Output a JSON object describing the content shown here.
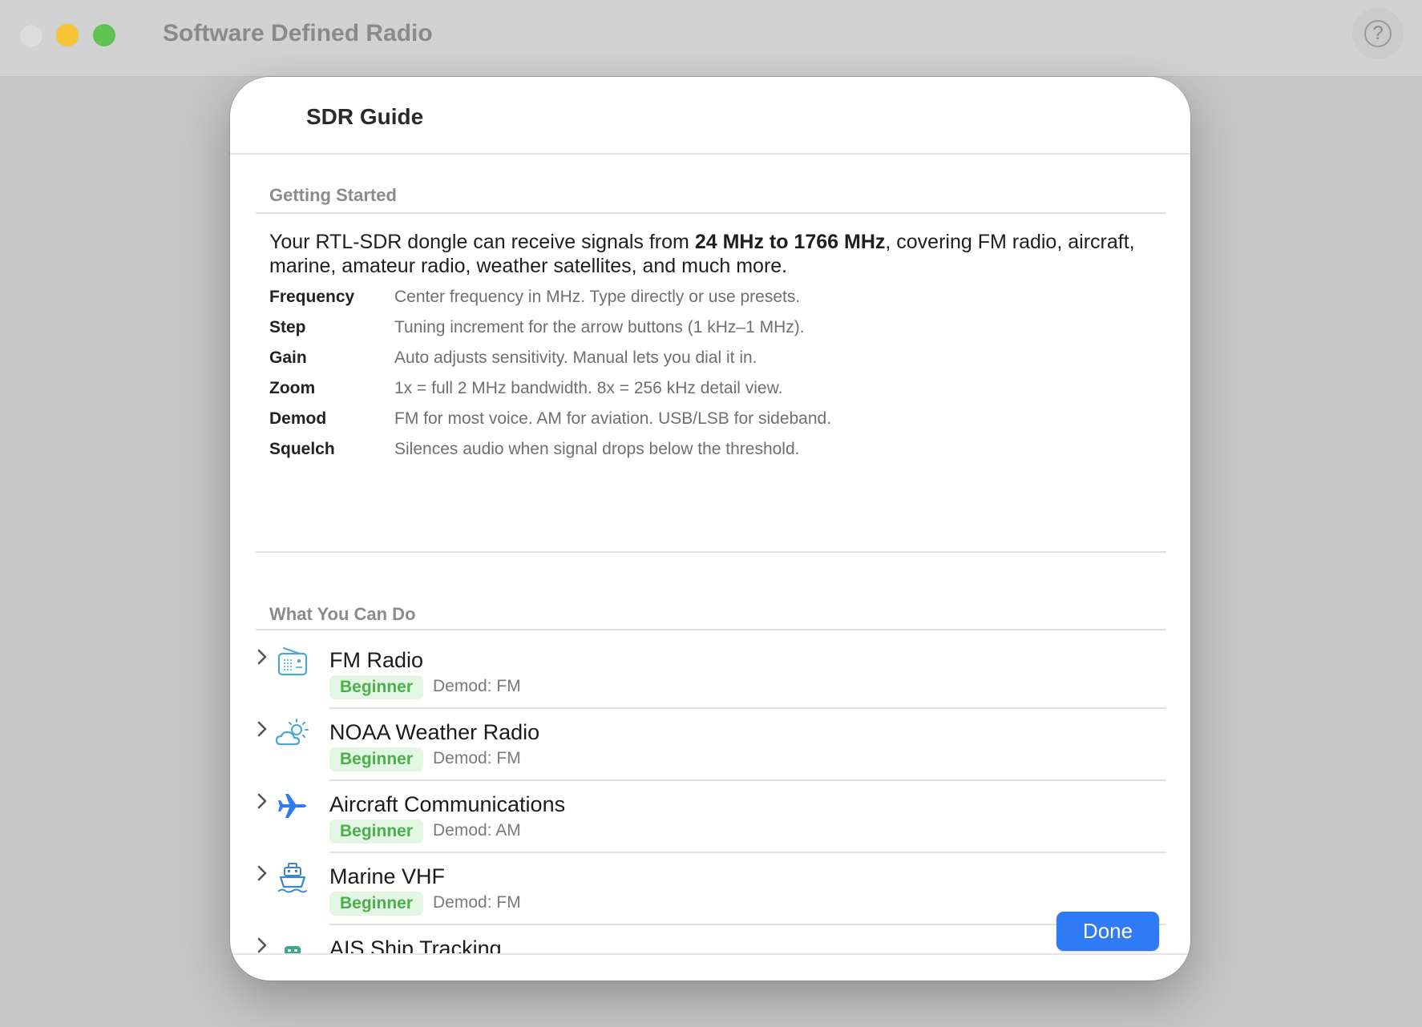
{
  "window": {
    "title": "Software Defined Radio",
    "help_label": "?"
  },
  "sheet": {
    "title": "SDR Guide",
    "getting_started": {
      "header": "Getting Started",
      "intro_prefix": "Your RTL-SDR dongle can receive signals from ",
      "intro_bold": "24 MHz to 1766 MHz",
      "intro_suffix": ", covering FM radio, aircraft, marine, amateur radio, weather satellites, and much more.",
      "definitions": [
        {
          "term": "Frequency",
          "desc": "Center frequency in MHz. Type directly or use presets."
        },
        {
          "term": "Step",
          "desc": "Tuning increment for the arrow buttons (1 kHz–1 MHz)."
        },
        {
          "term": "Gain",
          "desc": "Auto adjusts sensitivity. Manual lets you dial it in."
        },
        {
          "term": "Zoom",
          "desc": "1x = full 2 MHz bandwidth. 8x = 256 kHz detail view."
        },
        {
          "term": "Demod",
          "desc": "FM for most voice. AM for aviation. USB/LSB for sideband."
        },
        {
          "term": "Squelch",
          "desc": "Silences audio when signal drops below the threshold."
        }
      ]
    },
    "what_you_can_do": {
      "header": "What You Can Do",
      "items": [
        {
          "title": "FM Radio",
          "level": "Beginner",
          "demod": "Demod: FM",
          "icon": "radio-icon",
          "icon_color": "#4aa6d6"
        },
        {
          "title": "NOAA Weather Radio",
          "level": "Beginner",
          "demod": "Demod: FM",
          "icon": "cloud-sun-icon",
          "icon_color": "#4aa6d6"
        },
        {
          "title": "Aircraft Communications",
          "level": "Beginner",
          "demod": "Demod: AM",
          "icon": "airplane-icon",
          "icon_color": "#2f7bf5"
        },
        {
          "title": "Marine VHF",
          "level": "Beginner",
          "demod": "Demod: FM",
          "icon": "ferry-icon",
          "icon_color": "#3f86c9"
        },
        {
          "title": "AIS Ship Tracking",
          "level": "",
          "demod": "",
          "icon": "ferry-icon",
          "icon_color": "#3aa88f"
        }
      ]
    },
    "done_label": "Done"
  },
  "colors": {
    "accent": "#2f7bf5",
    "beginner_bg": "#e3f5e3",
    "beginner_text": "#4bb04b"
  }
}
